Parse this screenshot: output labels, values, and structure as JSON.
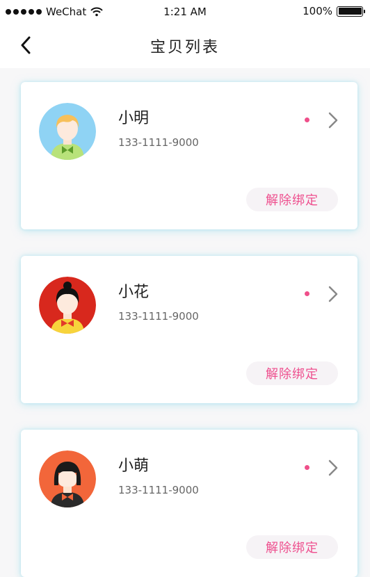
{
  "status_bar": {
    "carrier": "WeChat",
    "time": "1:21 AM",
    "battery": "100%"
  },
  "nav": {
    "title": "宝贝列表"
  },
  "children": [
    {
      "name": "小明",
      "phone": "133-1111-9000",
      "unbind_label": "解除绑定",
      "avatar": "boy-avatar",
      "avatar_bg": "#8fd3f4"
    },
    {
      "name": "小花",
      "phone": "133-1111-9000",
      "unbind_label": "解除绑定",
      "avatar": "girl-avatar",
      "avatar_bg": "#d8281d"
    },
    {
      "name": "小萌",
      "phone": "133-1111-9000",
      "unbind_label": "解除绑定",
      "avatar": "bob-hair-avatar",
      "avatar_bg": "#f2663a"
    }
  ],
  "colors": {
    "accent": "#ee4f8e",
    "unread_dot": "#ef4f8a",
    "card_glow": "#a8e3f0"
  }
}
